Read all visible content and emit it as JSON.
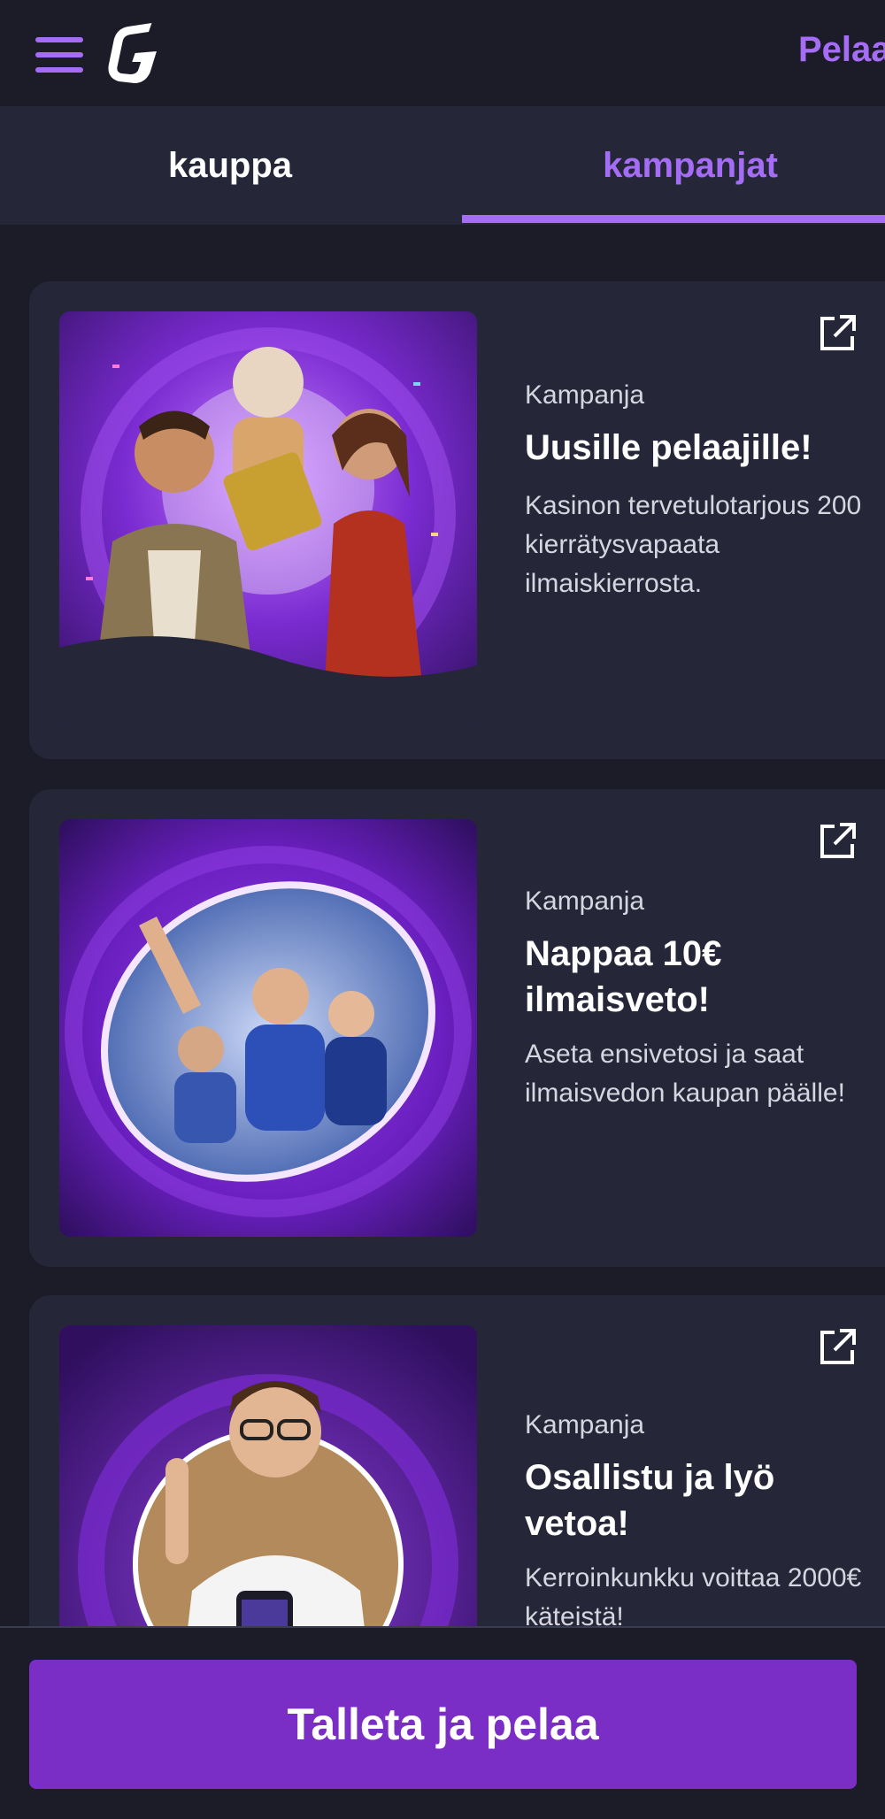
{
  "header": {
    "menu_icon": "hamburger-menu-icon",
    "logo_icon": "brand-g-logo",
    "play_link": "Pelaa"
  },
  "tabs": [
    {
      "label": "kauppa",
      "active": false
    },
    {
      "label": "kampanjat",
      "active": true
    }
  ],
  "promotions": [
    {
      "category": "Kampanja",
      "title": "Uusille pelaajille!",
      "description": "Kasinon tervetulotarjous 200 kierrätysvapaata ilmaiskierrosta.",
      "image": "casino-characters-illustration",
      "action_icon": "external-link-icon"
    },
    {
      "category": "Kampanja",
      "title": "Nappaa 10€ ilmaisveto!",
      "description": "Aseta ensivetosi ja saat ilmaisvedon kaupan päälle!",
      "image": "cheering-fans-portal-illustration",
      "action_icon": "external-link-icon"
    },
    {
      "category": "Kampanja",
      "title": "Osallistu ja lyö vetoa!",
      "description": "Kerroinkunkku voittaa 2000€ käteistä!",
      "image": "man-with-phone-illustration",
      "action_icon": "external-link-icon"
    }
  ],
  "cta": {
    "label": "Talleta ja pelaa"
  },
  "colors": {
    "background": "#1b1c28",
    "card": "#252738",
    "accent": "#a56cf5",
    "cta": "#7b2ec6"
  }
}
